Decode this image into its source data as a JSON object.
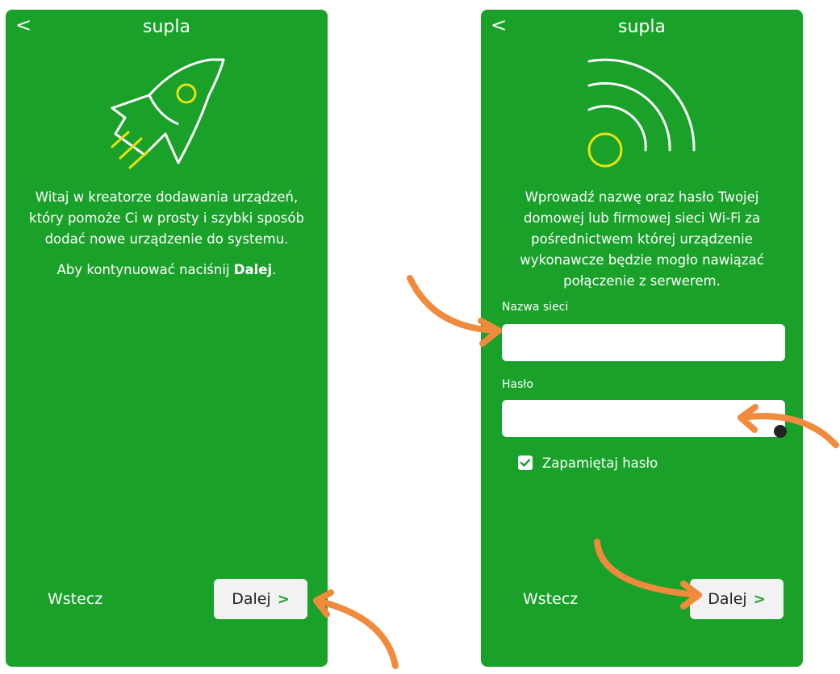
{
  "screens": [
    {
      "header": {
        "title": "supla",
        "back_icon": "<"
      },
      "hero_icon": "rocket-icon",
      "description": {
        "paragraph1": "Witaj w kreatorze dodawania urządzeń, który pomoże Ci w prosty i szybki sposób dodać nowe urządzenie do systemu.",
        "paragraph2_prefix": "Aby kontynuować naciśnij ",
        "paragraph2_bold": "Dalej",
        "paragraph2_suffix": "."
      },
      "footer": {
        "back_label": "Wstecz",
        "next_label": "Dalej",
        "next_chevron": ">"
      }
    },
    {
      "header": {
        "title": "supla",
        "back_icon": "<"
      },
      "hero_icon": "wifi-signal-icon",
      "description": {
        "paragraph1": "Wprowadź nazwę oraz hasło Twojej domowej lub firmowej sieci Wi-Fi za pośrednictwem której urządzenie wykonawcze będzie mogło nawiązać połączenie z serwerem."
      },
      "form": {
        "network_label": "Nazwa sieci",
        "network_value": "",
        "password_label": "Hasło",
        "password_value": "",
        "remember_label": "Zapamiętaj hasło",
        "remember_checked": true
      },
      "footer": {
        "back_label": "Wstecz",
        "next_label": "Dalej",
        "next_chevron": ">"
      }
    }
  ],
  "colors": {
    "screen_bg": "#1aa12a",
    "icon_line": "#ffffff",
    "icon_accent": "#e8e210",
    "arrow": "#f08a3c",
    "button_bg": "#f2f2f2"
  }
}
